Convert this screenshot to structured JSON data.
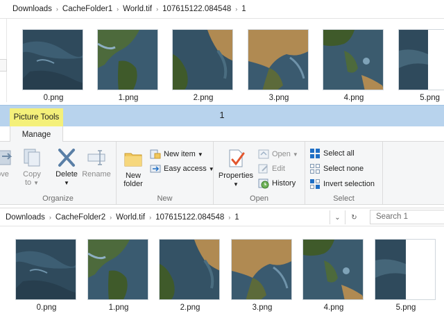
{
  "top_breadcrumb": {
    "items": [
      "Downloads",
      "CacheFolder1",
      "World.tif",
      "107615122.084548",
      "1"
    ],
    "separator": "›"
  },
  "top_thumbnails": [
    "0.png",
    "1.png",
    "2.png",
    "3.png",
    "4.png",
    "5.png"
  ],
  "ribbon": {
    "context_tab": "Picture Tools",
    "tab": "Manage",
    "window_title": "1",
    "groups": {
      "organize": {
        "label": "Organize",
        "move_to": "ove",
        "move_to_line2": "",
        "copy_to": "Copy",
        "copy_to_line2": "to",
        "delete": "Delete",
        "rename": "Rename"
      },
      "new": {
        "label": "New",
        "new_folder": "New",
        "new_folder_line2": "folder",
        "new_item": "New item",
        "easy_access": "Easy access"
      },
      "open": {
        "label": "Open",
        "properties": "Properties",
        "open": "Open",
        "edit": "Edit",
        "history": "History"
      },
      "select": {
        "label": "Select",
        "select_all": "Select all",
        "select_none": "Select none",
        "invert_selection": "Invert selection"
      }
    }
  },
  "bottom_breadcrumb": {
    "items": [
      "Downloads",
      "CacheFolder2",
      "World.tif",
      "107615122.084548",
      "1"
    ],
    "separator": "›"
  },
  "search": {
    "placeholder": "Search 1"
  },
  "bottom_thumbnails": [
    "0.png",
    "1.png",
    "2.png",
    "3.png",
    "4.png",
    "5.png"
  ],
  "colors": {
    "ocean_dark": "#2f4a5c",
    "ocean_light": "#6f93aa",
    "land_green": "#3f5a2a",
    "land_desert": "#b08a52",
    "context_bar": "#b8d3ed",
    "context_tab": "#f4f07a",
    "accent_blue": "#1f6fc5"
  },
  "icons": {
    "move_to": "folder-move-icon",
    "copy_to": "copy-icon",
    "delete": "delete-x-icon",
    "rename": "rename-icon",
    "new_folder": "new-folder-icon",
    "new_item": "new-item-icon",
    "easy_access": "easy-access-icon",
    "properties": "properties-check-icon",
    "open": "open-icon",
    "edit": "edit-icon",
    "history": "history-icon",
    "select_all": "select-all-icon",
    "select_none": "select-none-icon",
    "invert_selection": "invert-selection-icon",
    "refresh": "refresh-icon",
    "dropdown": "chevron-down-icon"
  }
}
